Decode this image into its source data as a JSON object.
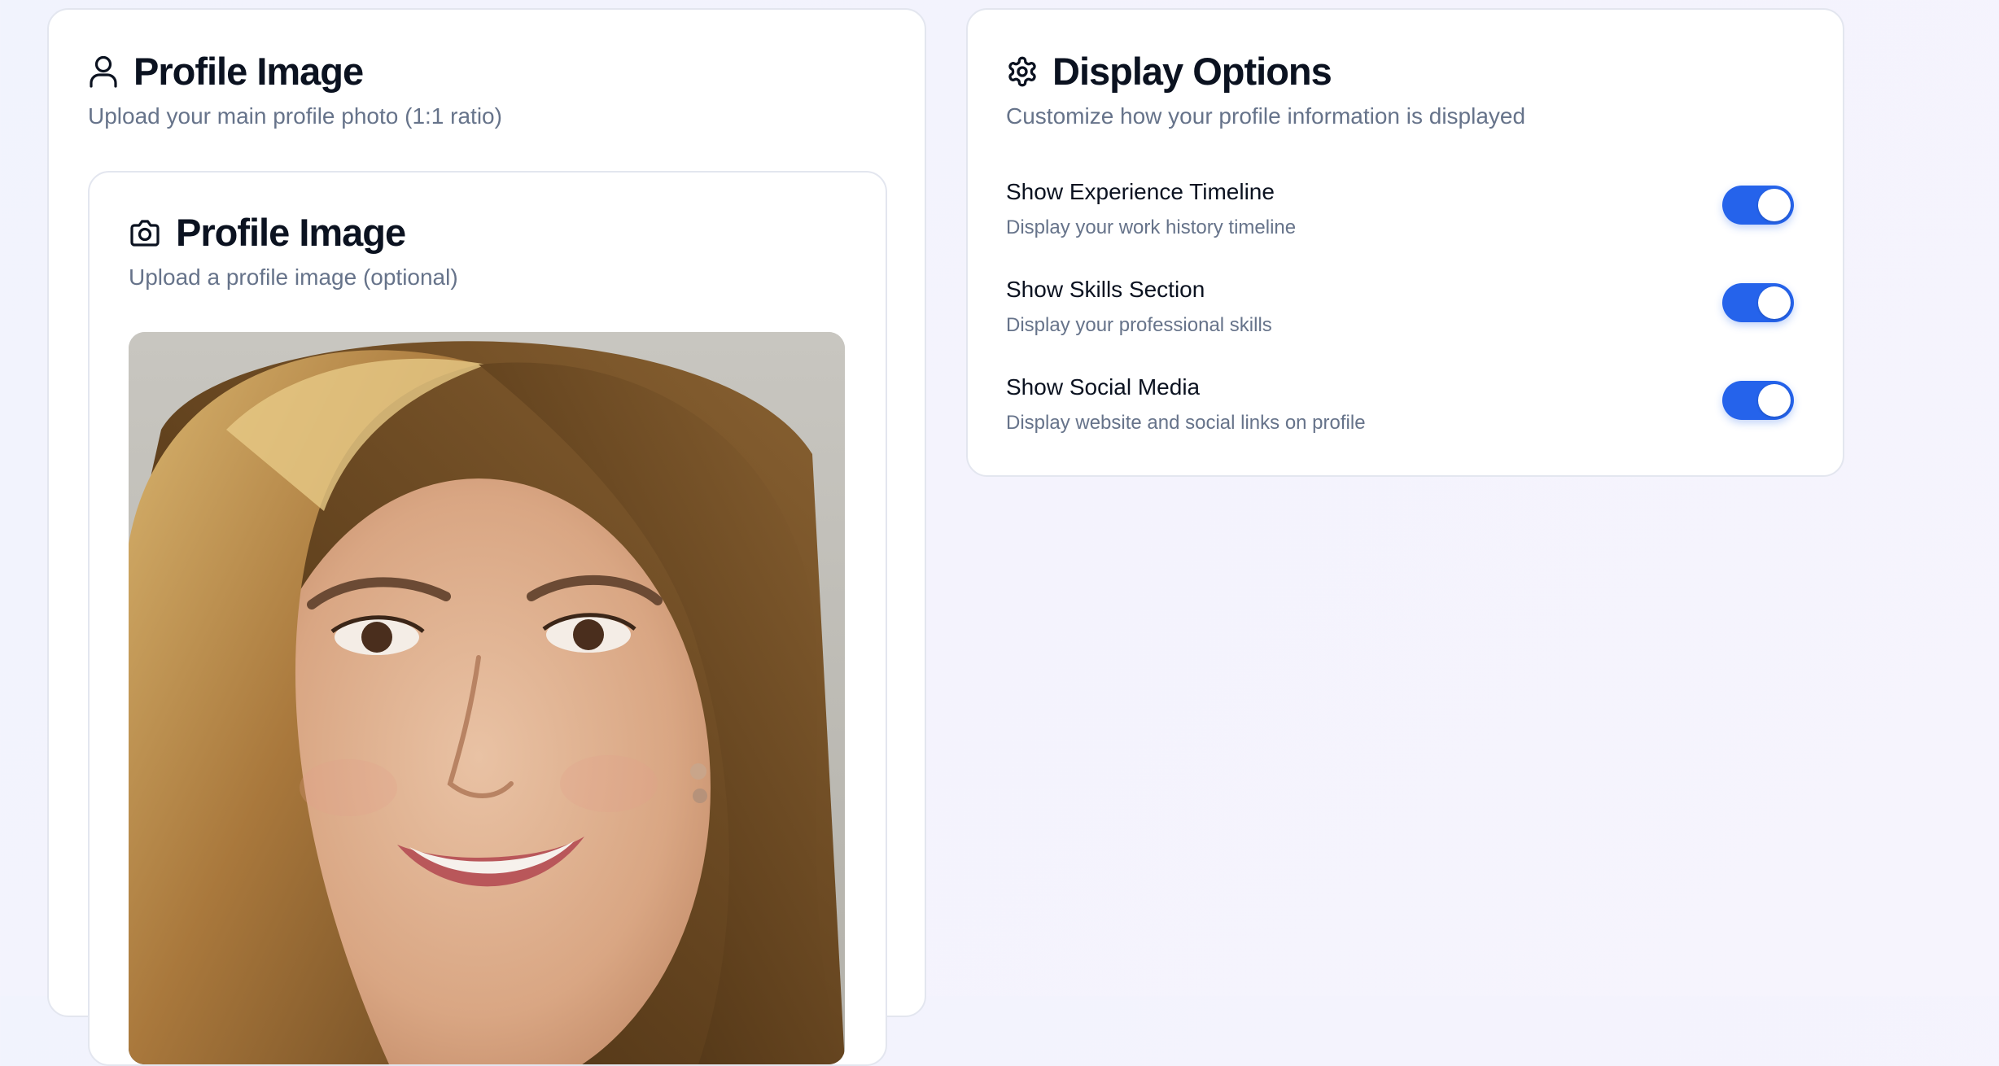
{
  "profile_section": {
    "title": "Profile Image",
    "subtitle": "Upload your main profile photo (1:1 ratio)",
    "icon": "user-icon",
    "upload_card": {
      "title": "Profile Image",
      "subtitle": "Upload a profile image (optional)",
      "icon": "camera-icon"
    }
  },
  "display_options": {
    "title": "Display Options",
    "subtitle": "Customize how your profile information is displayed",
    "icon": "gear-icon",
    "options": [
      {
        "label": "Show Experience Timeline",
        "description": "Display your work history timeline",
        "enabled": true
      },
      {
        "label": "Show Skills Section",
        "description": "Display your professional skills",
        "enabled": true
      },
      {
        "label": "Show Social Media",
        "description": "Display website and social links on profile",
        "enabled": true
      }
    ]
  },
  "colors": {
    "accent": "#2563eb",
    "text_primary": "#0b1220",
    "text_muted": "#66738a",
    "border": "#e3e6ef"
  }
}
